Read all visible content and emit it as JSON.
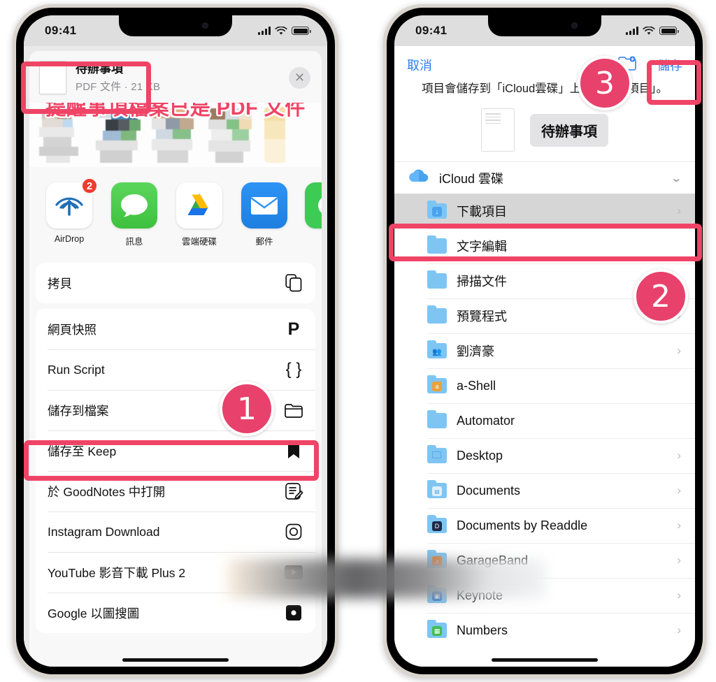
{
  "left_phone": {
    "status_bar": {
      "time": "09:41",
      "signal_icon": "cellular-bars-icon",
      "wifi_icon": "wifi-icon",
      "battery_icon": "battery-icon"
    },
    "share_sheet": {
      "doc_title": "待辦事項",
      "doc_subtitle": "PDF 文件 · 21 KB",
      "close_label": "✕",
      "headline_overlay": "提醒事項檔案已是 PDF 文件",
      "apps": [
        {
          "label": "AirDrop",
          "icon": "airdrop-icon",
          "badge": "2"
        },
        {
          "label": "訊息",
          "icon": "messages-icon",
          "badge": ""
        },
        {
          "label": "雲端硬碟",
          "icon": "google-drive-icon",
          "badge": ""
        },
        {
          "label": "郵件",
          "icon": "mail-icon",
          "badge": ""
        },
        {
          "label": "",
          "icon": "green-app-icon",
          "badge": ""
        }
      ],
      "group_one": [
        {
          "label": "拷貝",
          "icon": "copy-icon"
        }
      ],
      "group_two": [
        {
          "label": "網頁快照",
          "icon": "pocket-p-icon"
        },
        {
          "label": "Run Script",
          "icon": "braces-icon"
        },
        {
          "label": "儲存到檔案",
          "icon": "folder-icon"
        },
        {
          "label": "儲存至 Keep",
          "icon": "bookmark-icon"
        },
        {
          "label": "於 GoodNotes 中打開",
          "icon": "goodnotes-icon"
        },
        {
          "label": "Instagram Download",
          "icon": "instagram-icon"
        },
        {
          "label": "YouTube 影音下載 Plus 2",
          "icon": "youtube-icon"
        },
        {
          "label": "Google 以圖搜圖",
          "icon": "google-lens-icon"
        }
      ]
    }
  },
  "right_phone": {
    "status_bar": {
      "time": "09:41",
      "signal_icon": "cellular-bars-icon",
      "wifi_icon": "wifi-icon",
      "battery_icon": "battery-icon"
    },
    "save_sheet": {
      "cancel_label": "取消",
      "save_label": "儲存",
      "new_folder_icon": "new-folder-icon",
      "description": "項目會儲存到「iCloud雲碟」上的「下載項目」。",
      "file_name": "待辦事項",
      "source": {
        "label": "iCloud 雲碟",
        "icon": "icloud-icon",
        "chevron": "⌄"
      },
      "folders": [
        {
          "name": "下載項目",
          "icon": "folder-download-icon",
          "chevron": "›",
          "selected": true
        },
        {
          "name": "文字編輯",
          "icon": "folder-icon",
          "chevron": ""
        },
        {
          "name": "掃描文件",
          "icon": "folder-icon",
          "chevron": ""
        },
        {
          "name": "預覽程式",
          "icon": "folder-icon",
          "chevron": "›"
        },
        {
          "name": "劉濟豪",
          "icon": "folder-shared-icon",
          "chevron": "›"
        },
        {
          "name": "a-Shell",
          "icon": "folder-ashell-icon",
          "chevron": ""
        },
        {
          "name": "Automator",
          "icon": "folder-icon",
          "chevron": ""
        },
        {
          "name": "Desktop",
          "icon": "folder-desktop-icon",
          "chevron": "›"
        },
        {
          "name": "Documents",
          "icon": "folder-documents-icon",
          "chevron": "›"
        },
        {
          "name": "Documents by Readdle",
          "icon": "folder-readdle-icon",
          "chevron": "›"
        },
        {
          "name": "GarageBand",
          "icon": "folder-garageband-icon",
          "chevron": "›"
        },
        {
          "name": "Keynote",
          "icon": "folder-keynote-icon",
          "chevron": "›"
        },
        {
          "name": "Numbers",
          "icon": "folder-numbers-icon",
          "chevron": "›"
        }
      ]
    }
  },
  "annotations": {
    "accent_color": "#ef4466",
    "badge_color": "#e8416b",
    "steps": [
      {
        "number": "1"
      },
      {
        "number": "2"
      },
      {
        "number": "3"
      }
    ]
  }
}
